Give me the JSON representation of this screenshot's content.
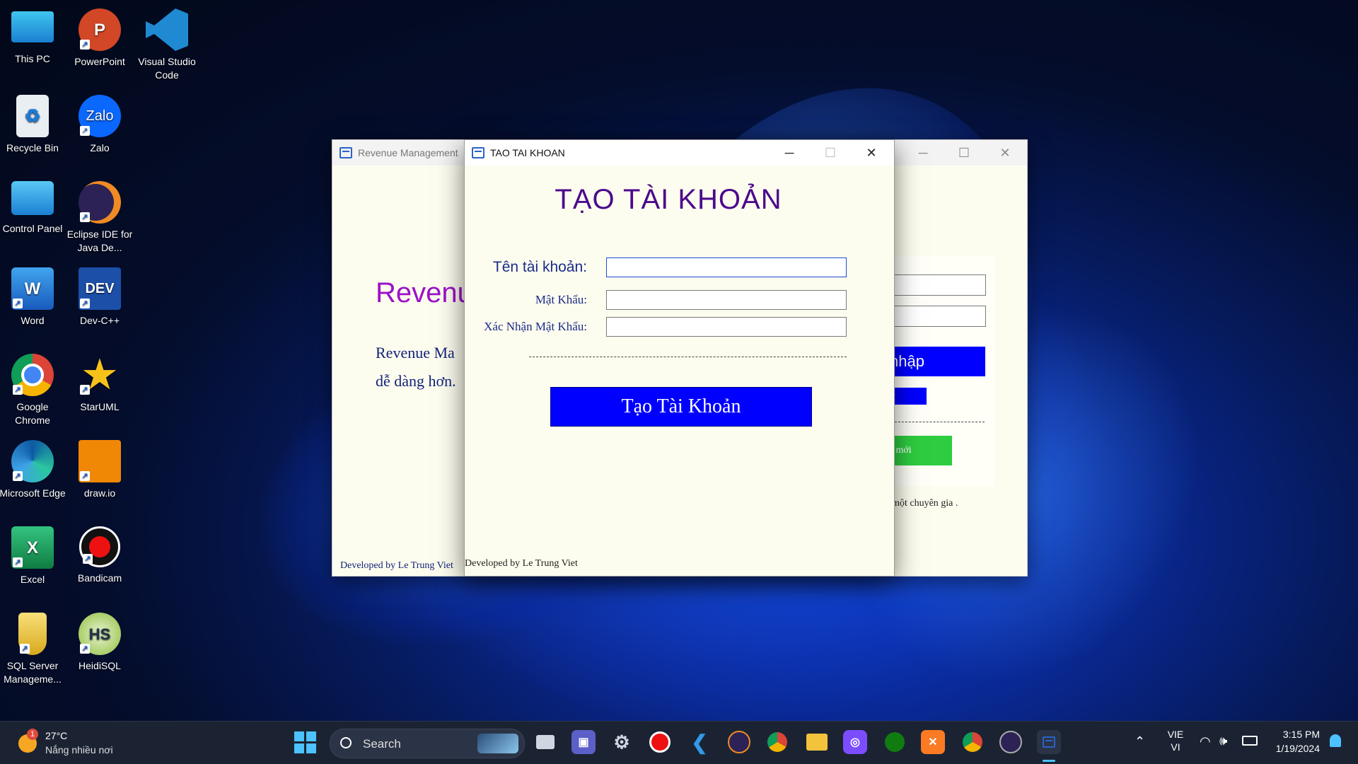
{
  "desktop": {
    "icons": [
      {
        "label": "This PC",
        "icon": "monitor-icon"
      },
      {
        "label": "PowerPoint",
        "icon": "powerpoint-icon"
      },
      {
        "label": "Visual Studio Code",
        "icon": "vscode-icon"
      },
      {
        "label": "Recycle Bin",
        "icon": "recycle-bin-icon"
      },
      {
        "label": "Zalo",
        "icon": "zalo-icon"
      },
      {
        "label": "Control Panel",
        "icon": "control-panel-icon"
      },
      {
        "label": "Eclipse IDE for Java De...",
        "icon": "eclipse-icon"
      },
      {
        "label": "Word",
        "icon": "word-icon"
      },
      {
        "label": "Dev-C++",
        "icon": "devcpp-icon"
      },
      {
        "label": "Google Chrome",
        "icon": "chrome-icon"
      },
      {
        "label": "StarUML",
        "icon": "staruml-icon"
      },
      {
        "label": "Microsoft Edge",
        "icon": "edge-icon"
      },
      {
        "label": "draw.io",
        "icon": "drawio-icon"
      },
      {
        "label": "Excel",
        "icon": "excel-icon"
      },
      {
        "label": "Bandicam",
        "icon": "bandicam-icon"
      },
      {
        "label": "SQL Server Manageme...",
        "icon": "sql-server-icon"
      },
      {
        "label": "HeidiSQL",
        "icon": "heidisql-icon"
      }
    ]
  },
  "bg_window": {
    "title": "Revenue Management",
    "heading": "Revenu",
    "text_line1": "Revenue Ma",
    "text_line2": "dễ dàng hơn.",
    "login_button": "nhập",
    "forgot_button": "?",
    "new_account_button": "n mới",
    "expert_text": "ư một chuyên gia .",
    "footer": "Developed by Le Trung Viet"
  },
  "dialog": {
    "title": "TAO TAI KHOAN",
    "heading": "TẠO TÀI KHOẢN",
    "username_label": "Tên tài khoản:",
    "username_value": "",
    "password_label": "Mật Khẩu:",
    "password_value": "",
    "confirm_label": "Xác Nhận Mật Khẩu:",
    "confirm_value": "",
    "submit_button": "Tạo Tài Khoản",
    "footer": "Developed by Le Trung Viet"
  },
  "taskbar": {
    "weather_temp": "27°C",
    "weather_desc": "Nắng nhiều nơi",
    "weather_badge": "1",
    "search_label": "Search",
    "language_top": "VIE",
    "language_bottom": "VI",
    "time": "3:15 PM",
    "date": "1/19/2024",
    "colors": {
      "accent": "#0000ff",
      "button_green": "#2ecc40",
      "heading_purple": "#4b0a8c"
    }
  }
}
